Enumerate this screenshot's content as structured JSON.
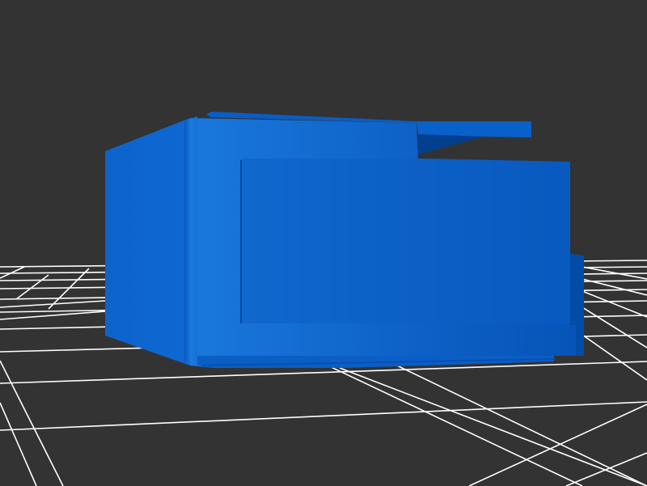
{
  "scene": {
    "background_color": "#333333",
    "grid_color": "#ffffff",
    "object": "blue-box-model",
    "object_colors": {
      "front_main": "#0d5fc7",
      "front_light": "#1a72d9",
      "side": "#0e62c9",
      "top_rim": "#0b5ac0",
      "shadow": "#034aa6",
      "dark_slot": "#023f8f"
    }
  }
}
